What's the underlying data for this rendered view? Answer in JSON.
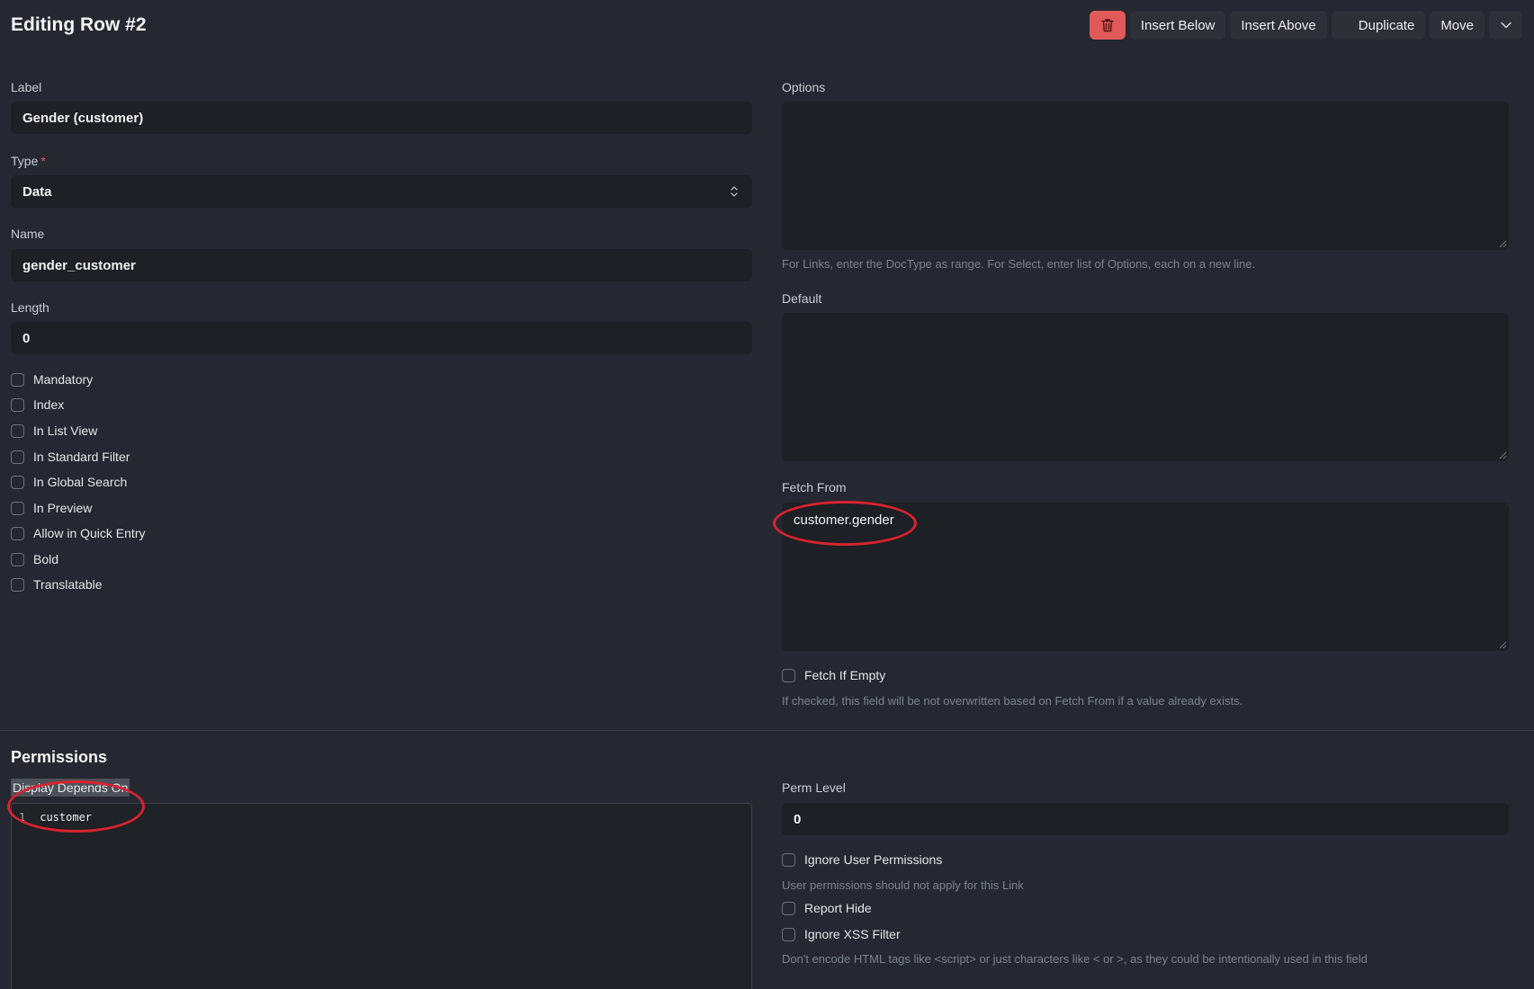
{
  "header": {
    "title": "Editing Row #2",
    "actions": {
      "insert_below": "Insert Below",
      "insert_above": "Insert Above",
      "duplicate": "Duplicate",
      "move": "Move"
    }
  },
  "left": {
    "label": {
      "label": "Label",
      "value": "Gender (customer)"
    },
    "type": {
      "label": "Type",
      "required_mark": "*",
      "value": "Data"
    },
    "name": {
      "label": "Name",
      "value": "gender_customer"
    },
    "length": {
      "label": "Length",
      "value": "0"
    },
    "checkboxes": [
      "Mandatory",
      "Index",
      "In List View",
      "In Standard Filter",
      "In Global Search",
      "In Preview",
      "Allow in Quick Entry",
      "Bold",
      "Translatable"
    ]
  },
  "right": {
    "options": {
      "label": "Options",
      "value": "",
      "help": "For Links, enter the DocType as range. For Select, enter list of Options, each on a new line."
    },
    "default": {
      "label": "Default",
      "value": ""
    },
    "fetch_from": {
      "label": "Fetch From",
      "value": "customer.gender"
    },
    "fetch_if_empty": {
      "label": "Fetch If Empty",
      "help": "If checked, this field will be not overwritten based on Fetch From if a value already exists."
    }
  },
  "permissions": {
    "title": "Permissions",
    "display_depends_on": {
      "label": "Display Depends On",
      "line_number": "1",
      "code": "customer"
    },
    "perm_level": {
      "label": "Perm Level",
      "value": "0"
    },
    "ignore_user_permissions": {
      "label": "Ignore User Permissions",
      "help": "User permissions should not apply for this Link"
    },
    "report_hide": {
      "label": "Report Hide"
    },
    "ignore_xss_filter": {
      "label": "Ignore XSS Filter",
      "help": "Don't encode HTML tags like <script> or just characters like < or >, as they could be intentionally used in this field"
    }
  },
  "colors": {
    "background": "#252830",
    "input": "#1d2025",
    "danger": "#e05a5a",
    "annotation": "#d7232e"
  }
}
